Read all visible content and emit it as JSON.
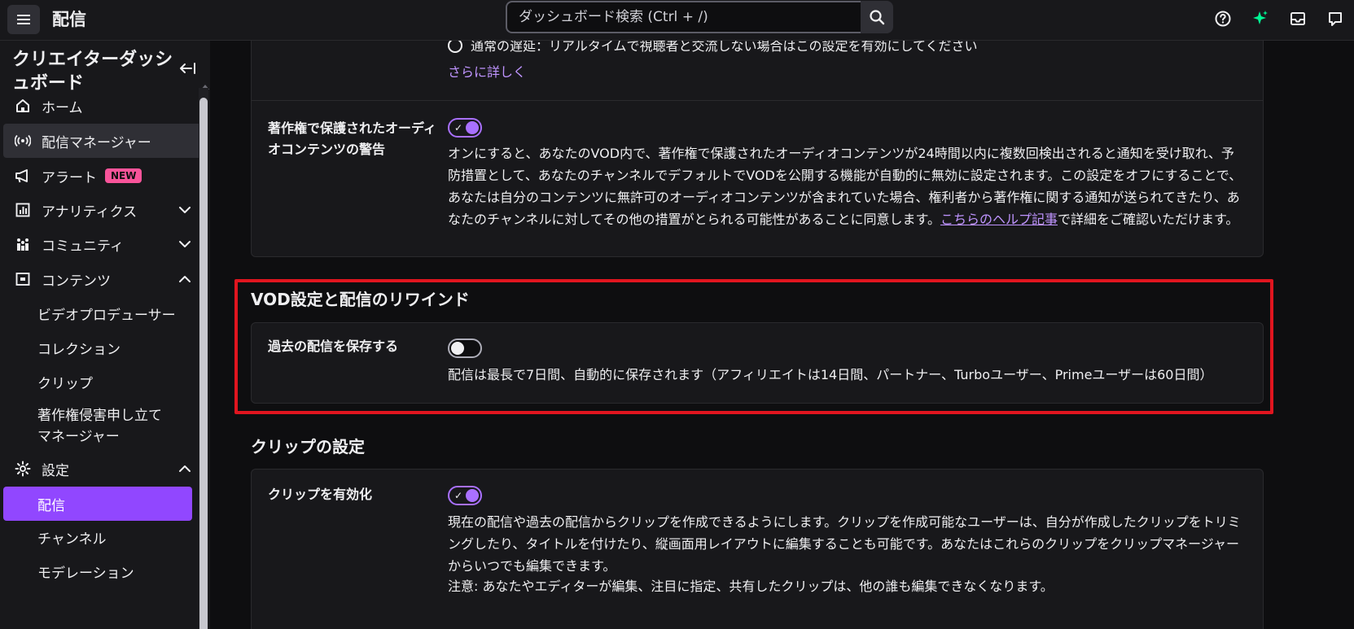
{
  "header": {
    "title": "配信",
    "search_placeholder": "ダッシュボード検索 (Ctrl + /)"
  },
  "sidebar": {
    "title": "クリエイターダッシュボード",
    "items": [
      {
        "label": "ホーム"
      },
      {
        "label": "配信マネージャー"
      },
      {
        "label": "アラート",
        "badge": "NEW"
      },
      {
        "label": "アナリティクス"
      },
      {
        "label": "コミュニティ"
      },
      {
        "label": "コンテンツ"
      },
      {
        "label": "ビデオプロデューサー"
      },
      {
        "label": "コレクション"
      },
      {
        "label": "クリップ"
      },
      {
        "label": "著作権侵害申し立てマネージャー"
      },
      {
        "label": "設定"
      },
      {
        "label": "配信"
      },
      {
        "label": "チャンネル"
      },
      {
        "label": "モデレーション"
      }
    ]
  },
  "main": {
    "latency": {
      "radio_label": "通常の遅延：リアルタイムで視聴者と交流しない場合はこの設定を有効にしてください",
      "more_link": "さらに詳しく"
    },
    "copyright": {
      "label": "著作権で保護されたオーディオコンテンツの警告",
      "toggle_on": true,
      "text_before_link": "オンにすると、あなたのVOD内で、著作権で保護されたオーディオコンテンツが24時間以内に複数回検出されると通知を受け取れ、予防措置として、あなたのチャンネルでデフォルトでVODを公開する機能が自動的に無効に設定されます。この設定をオフにすることで、あなたは自分のコンテンツに無許可のオーディオコンテンツが含まれていた場合、権利者から著作権に関する通知が送られてきたり、あなたのチャンネルに対してその他の措置がとられる可能性があることに同意します。",
      "link": "こちらのヘルプ記事",
      "text_after_link": "で詳細をご確認いただけます。"
    },
    "vod_section": {
      "title": "VOD設定と配信のリワインド",
      "store_label": "過去の配信を保存する",
      "toggle_on": false,
      "store_text": "配信は最長で7日間、自動的に保存されます（アフィリエイトは14日間、パートナー、Turboユーザー、Primeユーザーは60日間）"
    },
    "clip_section": {
      "title": "クリップの設定",
      "enable_label": "クリップを有効化",
      "toggle_on": true,
      "enable_text": "現在の配信や過去の配信からクリップを作成できるようにします。クリップを作成可能なユーザーは、自分が作成したクリップをトリミングしたり、タイトルを付けたり、縦画面用レイアウトに編集することも可能です。あなたはこれらのクリップをクリップマネージャーからいつでも編集できます。",
      "note": "注意: あなたやエディターが編集、注目に指定、共有したクリップは、他の誰も編集できなくなります。"
    }
  },
  "colors": {
    "accent": "#9147ff",
    "link": "#bf94ff",
    "highlight": "#e0151f"
  }
}
